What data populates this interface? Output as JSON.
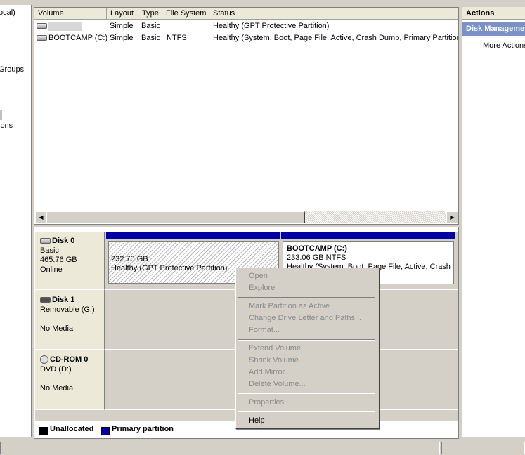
{
  "tree": {
    "items": [
      "ocal)",
      "Groups",
      "ions"
    ]
  },
  "volume_list": {
    "headers": [
      "Volume",
      "Layout",
      "Type",
      "File System",
      "Status"
    ],
    "rows": [
      {
        "volume": "",
        "layout": "Simple",
        "type": "Basic",
        "fs": "",
        "status": "Healthy (GPT Protective Partition)"
      },
      {
        "volume": "BOOTCAMP (C:)",
        "layout": "Simple",
        "type": "Basic",
        "fs": "NTFS",
        "status": "Healthy (System, Boot, Page File, Active, Crash Dump, Primary Partition)"
      }
    ]
  },
  "disks": [
    {
      "name": "Disk 0",
      "type": "Basic",
      "size": "465.76 GB",
      "state": "Online"
    },
    {
      "name": "Disk 1",
      "type": "Removable (G:)",
      "size": "",
      "state": "No Media"
    },
    {
      "name": "CD-ROM 0",
      "type": "DVD (D:)",
      "size": "",
      "state": "No Media"
    }
  ],
  "partitions": [
    {
      "name": "",
      "size": "232.70 GB",
      "status": "Healthy (GPT Protective Partition)"
    },
    {
      "name": "BOOTCAMP  (C:)",
      "size": "233.06 GB NTFS",
      "status": "Healthy (System, Boot, Page File, Active, Crash Dump, Primary Partition)"
    }
  ],
  "legend": {
    "unallocated": "Unallocated",
    "primary": "Primary partition"
  },
  "actions": {
    "title": "Actions",
    "section": "Disk Management",
    "more": "More Actions"
  },
  "context_menu": {
    "open": "Open",
    "explore": "Explore",
    "mark_active": "Mark Partition as Active",
    "change_letter": "Change Drive Letter and Paths...",
    "format": "Format...",
    "extend": "Extend Volume...",
    "shrink": "Shrink Volume...",
    "add_mirror": "Add Mirror...",
    "delete": "Delete Volume...",
    "properties": "Properties",
    "help": "Help"
  },
  "colors": {
    "primary_partition": "#0000a0",
    "unallocated": "#000000",
    "actions_header": "#7b92c4"
  }
}
